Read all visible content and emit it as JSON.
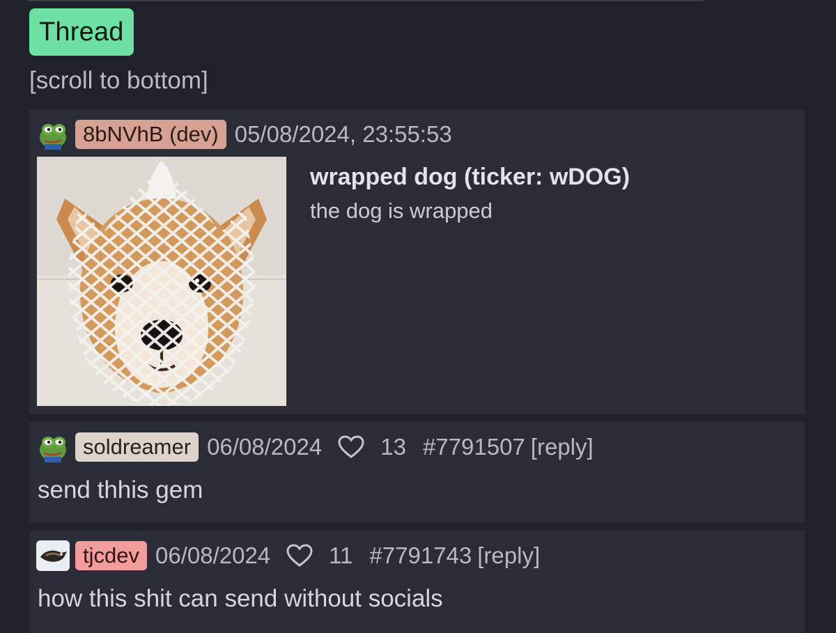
{
  "header": {
    "thread_label": "Thread",
    "scroll_link": "[scroll to bottom]"
  },
  "op": {
    "username": "8bNVhB (dev)",
    "date": "05/08/2024, 23:55:53",
    "token_title": "wrapped dog (ticker: wDOG)",
    "token_description": "the dog is wrapped",
    "avatar": "frog-avatar",
    "image": "shiba-dog-in-white-net"
  },
  "replies": [
    {
      "username": "soldreamer",
      "date": "06/08/2024",
      "likes": "13",
      "post_id": "#7791507",
      "reply_label": "[reply]",
      "text": "send thhis gem",
      "avatar": "frog-avatar"
    },
    {
      "username": "tjcdev",
      "date": "06/08/2024",
      "likes": "11",
      "post_id": "#7791743",
      "reply_label": "[reply]",
      "text": "how this shit can send without socials",
      "avatar": "bird-avatar"
    }
  ],
  "colors": {
    "background": "#1f222a",
    "card": "#2a2d38",
    "thread_badge": "#6ee0a4",
    "dev_chip": "#d7a293",
    "user_chip": "#ddd3cb",
    "pink_chip": "#f39c9c"
  },
  "icons": [
    "frog-avatar-icon",
    "bird-avatar-icon",
    "heart-icon"
  ]
}
